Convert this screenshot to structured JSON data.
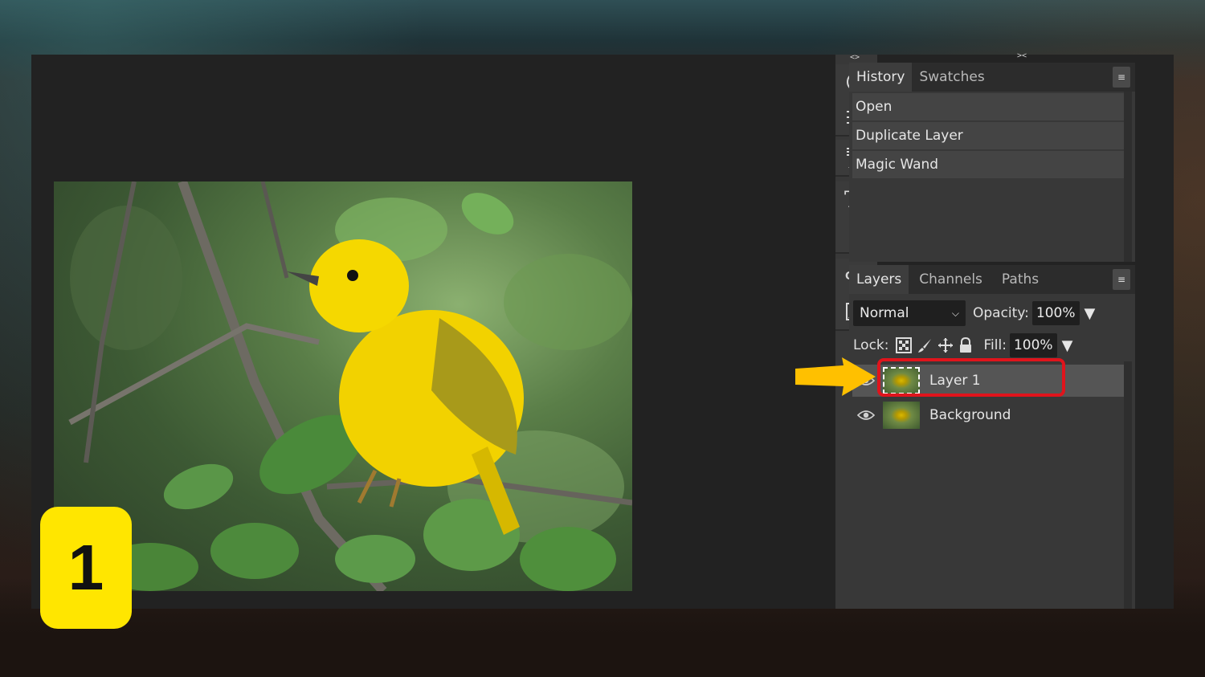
{
  "step": {
    "number": "1"
  },
  "colors": {
    "accent_highlight": "#e0141c",
    "arrow": "#ffc000",
    "badge": "#ffe600"
  },
  "toolbar": {
    "arrows_left": "<>",
    "arrows_right": "><",
    "icons": [
      "info-icon",
      "adjustments-icon",
      "brush-settings-icon",
      "text-icon",
      "paragraph-icon",
      "css-icon",
      "image-icon"
    ],
    "css_label": "CSS"
  },
  "history_panel": {
    "tabs": [
      "History",
      "Swatches"
    ],
    "active_tab": "History",
    "items": [
      "Open",
      "Duplicate Layer",
      "Magic Wand"
    ]
  },
  "layers_panel": {
    "tabs": [
      "Layers",
      "Channels",
      "Paths"
    ],
    "active_tab": "Layers",
    "blend_mode": "Normal",
    "opacity_label": "Opacity:",
    "opacity_value": "100%",
    "lock_label": "Lock:",
    "fill_label": "Fill:",
    "fill_value": "100%",
    "layers": [
      {
        "name": "Layer 1",
        "selected": true
      },
      {
        "name": "Background",
        "selected": false
      }
    ]
  }
}
